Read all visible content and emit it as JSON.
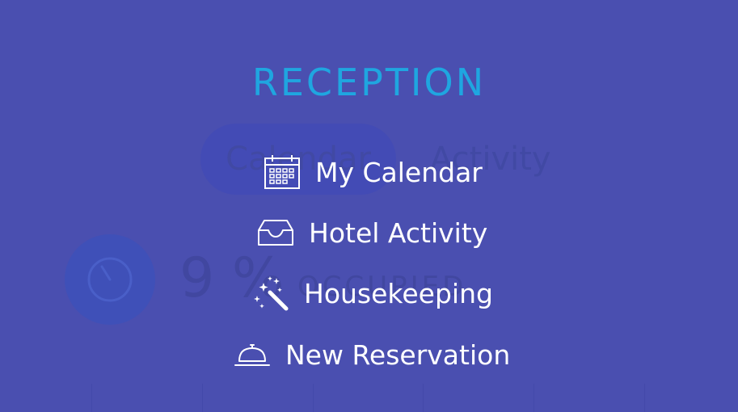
{
  "background": {
    "tabs": [
      {
        "label": "Calendar"
      },
      {
        "label": "Activity"
      }
    ],
    "occupancy_value": "9 %",
    "occupancy_label": "OCCUPIED"
  },
  "menu": {
    "title": "RECEPTION",
    "items": [
      {
        "label": "My Calendar",
        "icon": "calendar-icon"
      },
      {
        "label": "Hotel Activity",
        "icon": "inbox-icon"
      },
      {
        "label": "Housekeeping",
        "icon": "magic-wand-icon"
      },
      {
        "label": "New Reservation",
        "icon": "service-bell-icon"
      }
    ]
  },
  "colors": {
    "background": "#4a4fb0",
    "title": "#1fa6e0",
    "menu_text": "#ffffff"
  }
}
